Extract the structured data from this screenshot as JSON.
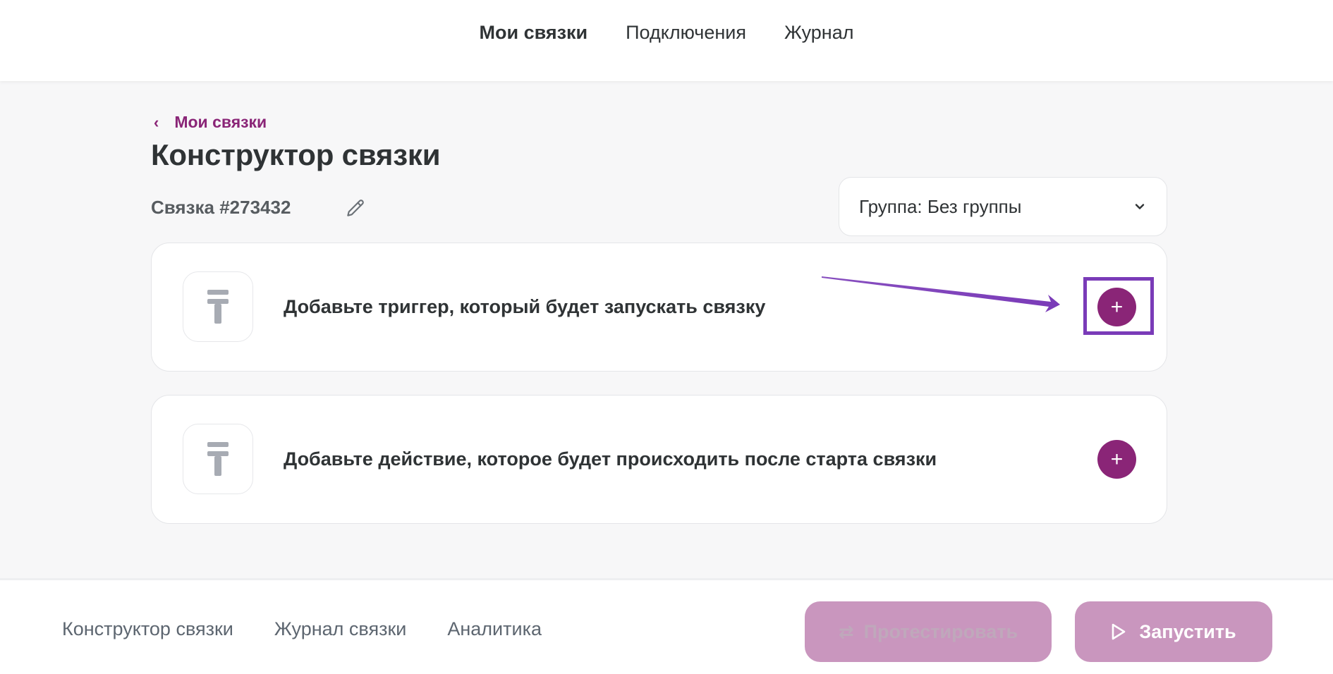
{
  "top_nav": {
    "items": [
      {
        "label": "Мои связки",
        "active": true
      },
      {
        "label": "Подключения",
        "active": false
      },
      {
        "label": "Журнал",
        "active": false
      }
    ]
  },
  "header": {
    "back_label": "Мои связки",
    "title": "Конструктор связки",
    "bundle_label": "Связка #273432"
  },
  "group_select": {
    "value": "Группа: Без группы"
  },
  "steps": [
    {
      "text": "Добавьте триггер, который будет запускать связку",
      "button": "+"
    },
    {
      "text": "Добавьте действие, которое будет происходить после старта связки",
      "button": "+"
    }
  ],
  "bottom_tabs": [
    "Конструктор связки",
    "Журнал связки",
    "Аналитика"
  ],
  "buttons": {
    "test_label": "Протестировать",
    "run_label": "Запустить"
  },
  "colors": {
    "accent": "#8a2577",
    "button_disabled": "#c996be",
    "highlight": "#7a3bb8"
  },
  "icons": {
    "back": "chevron-left-icon",
    "edit": "pencil-icon",
    "select": "chevron-down-icon",
    "app_placeholder": "app-placeholder-icon",
    "add": "plus-icon",
    "test": "swap-arrows-icon",
    "run": "play-icon"
  }
}
